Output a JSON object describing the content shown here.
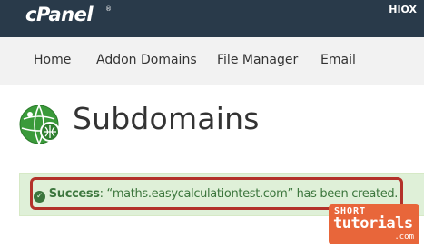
{
  "header": {
    "logo_text": "cPanel",
    "logo_reg": "®",
    "account_label": "HIOX"
  },
  "nav": {
    "items": [
      {
        "label": "Home"
      },
      {
        "label": "Addon Domains"
      },
      {
        "label": "File Manager"
      },
      {
        "label": "Email"
      }
    ]
  },
  "page": {
    "title": "Subdomains",
    "icon": "subdomains-globe-icon"
  },
  "alert": {
    "icon": "check-circle-icon",
    "strong": "Success",
    "colon": ":",
    "message": " “maths.easycalculationtest.com” has been created."
  },
  "watermark": {
    "line1": "SHORT",
    "line2": "tutorials",
    "line3": ".com"
  },
  "colors": {
    "topbar_bg": "#293a4a",
    "nav_bg": "#f2f2f2",
    "alert_bg": "#dff0d8",
    "alert_text": "#3c763d",
    "highlight_border": "#b3322a",
    "watermark_bg": "#e8663a",
    "icon_green": "#3a9a3a"
  }
}
